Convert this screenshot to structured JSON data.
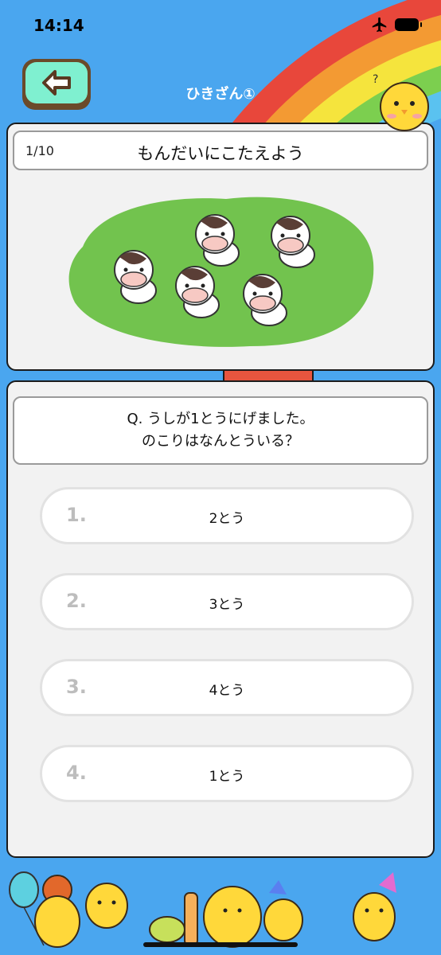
{
  "status": {
    "time": "14:14"
  },
  "header": {
    "title": "ひきざん①"
  },
  "quiz": {
    "progress": "1/10",
    "instruction": "もんだいにこたえよう",
    "question_line1": "Q. うしが1とうにげました。",
    "question_line2": "のこりはなんとういる？",
    "answers": [
      {
        "num": "1.",
        "label": "2とう"
      },
      {
        "num": "2.",
        "label": "3とう"
      },
      {
        "num": "3.",
        "label": "4とう"
      },
      {
        "num": "4.",
        "label": "1とう"
      }
    ]
  },
  "colors": {
    "sky": "#4aa6ef",
    "back_button": "#7ff0d0",
    "pasture": "#72c34e",
    "card": "#f2f2f2"
  }
}
